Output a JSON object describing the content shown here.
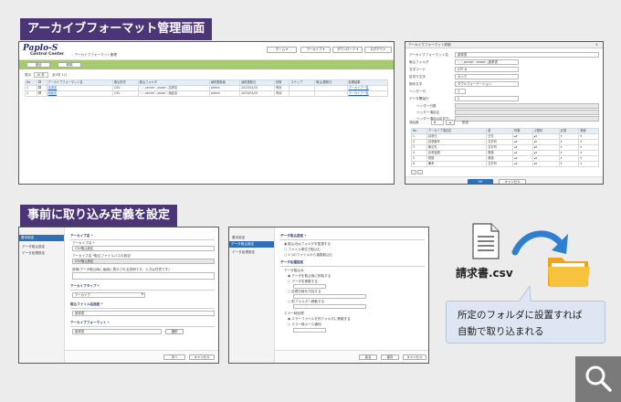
{
  "archive_mgmt": {
    "tab_title": "アーカイブフォーマット管理画面",
    "app_logo": "Paplo-S",
    "app_subtitle": "Control Center",
    "app_breadcrumb": "- アーカイブフォーマット管理",
    "header_buttons": [
      "ホーム",
      "アーカイブ",
      "ダウンロード",
      "ログアウト"
    ],
    "toolbar_buttons": [
      "追加",
      "削除"
    ],
    "filter_label": "表示",
    "filter_value": "10 件",
    "filter_count": "全2件 1/1",
    "columns": [
      "No",
      "",
      "アーカイブフォーマット名",
      "取込形式",
      "取込フォルダ",
      "最終更新者",
      "最終更新日",
      "状態",
      "ステップ",
      "取込/更新日",
      "処理結果"
    ],
    "rows": [
      {
        "no": "1",
        "name": "請求書",
        "format": "CSV",
        "folder": "＼＼server＼share＼請求書",
        "user": "admin",
        "date": "2023/04/01",
        "state": "有効",
        "action": "アーカイブ一覧"
      },
      {
        "no": "2",
        "name": "納品書",
        "format": "CSV",
        "folder": "＼＼server＼share＼納品書",
        "user": "admin",
        "date": "2023/04/01",
        "state": "有効",
        "action": "アーカイブ一覧"
      }
    ]
  },
  "format_dialog": {
    "title": "アーカイブフォーマット詳細",
    "fields": [
      {
        "label": "アーカイブフォーマット名",
        "value": "請求書"
      },
      {
        "label": "取込フォルダ",
        "value": "＼＼server＼share＼請求書"
      },
      {
        "label": "文字コード",
        "value": "UTF-8"
      },
      {
        "label": "区切り文字",
        "value": "カンマ"
      },
      {
        "label": "囲み文字",
        "value": "ダブルクォーテーション"
      },
      {
        "label": "ヘッダー行",
        "value": "1"
      },
      {
        "label": "データ開始行",
        "value": "2"
      }
    ],
    "sub_fields": [
      "ヘッダー行数",
      "ヘッダー項目名",
      "ヘッダー項目の区切り"
    ],
    "count_label": "項目数",
    "count_value": "6",
    "count_btn": "設定",
    "columns": [
      "No",
      "アーカイブ項目名",
      "型",
      "桁数",
      "小数桁",
      "必須",
      "検索"
    ],
    "rows": [
      {
        "no": "1",
        "name": "請求日",
        "type": "日付"
      },
      {
        "no": "2",
        "name": "請求番号",
        "type": "文字列"
      },
      {
        "no": "3",
        "name": "取引先",
        "type": "文字列"
      },
      {
        "no": "4",
        "name": "請求金額",
        "type": "数値"
      },
      {
        "no": "5",
        "name": "税額",
        "type": "数値"
      },
      {
        "no": "6",
        "name": "備考",
        "type": "文字列"
      }
    ],
    "ok": "OK",
    "cancel": "キャンセル"
  },
  "import_setup": {
    "tab_title": "事前に取り込み定義を設定",
    "left_dialog": {
      "side_items": [
        "基本設定",
        "データ取込設定",
        "データ処理設定"
      ],
      "section_title": "アーカイブ名 *",
      "name_label": "アーカイブ名 *",
      "name_value": "CSV取込設定",
      "path_label": "アーカイブ名 *取込ファイルパスの設定",
      "path_value": "CSV取込設定",
      "desc_label": "説明(データ取込時に画面に表示される説明です。入力は任意です)",
      "type_title": "アーカイブタイプ *",
      "type_value": "アーカイブ",
      "file_title": "取込ファイル名指定 *",
      "file_value": "請求書",
      "format_title": "アーカイブフォーマット *",
      "format_value": "請求書",
      "format_btn": "選択",
      "next": "次へ",
      "cancel": "キャンセル"
    },
    "right_dialog": {
      "side_items": [
        "基本設定",
        "データ取込設定",
        "データ処理設定"
      ],
      "sec1_title": "データ取込設定 *",
      "sec1_opts": [
        "取込みはフォルダを監視する",
        "ファイル単位で取込む",
        "1つのファイルから複数取込む"
      ],
      "sec2_title": "データ処理設定",
      "sub_a": "データ取込み",
      "sub_a_opts": [
        "データを取込後に削除する",
        "データを移動する",
        "処理日時を付加する",
        "別フォルダへ移動する"
      ],
      "sub_b": "エラー時処理",
      "sub_b_opts": [
        "エラーファイルを別フォルダに移動する",
        "エラー時メール通知"
      ],
      "back": "戻る",
      "save": "保存",
      "cancel": "キャンセル"
    },
    "csv_filename": "請求書.csv",
    "callout_line1": "所定のフォルダに設置すれば",
    "callout_line2": "自動で取り込まれる"
  },
  "colors": {
    "accent": "#4a3577",
    "callout_bg": "#dfe6f3",
    "arrow": "#2f7fd1",
    "folder": "#f3b632",
    "magnifier_bg": "#7a7a7a"
  }
}
